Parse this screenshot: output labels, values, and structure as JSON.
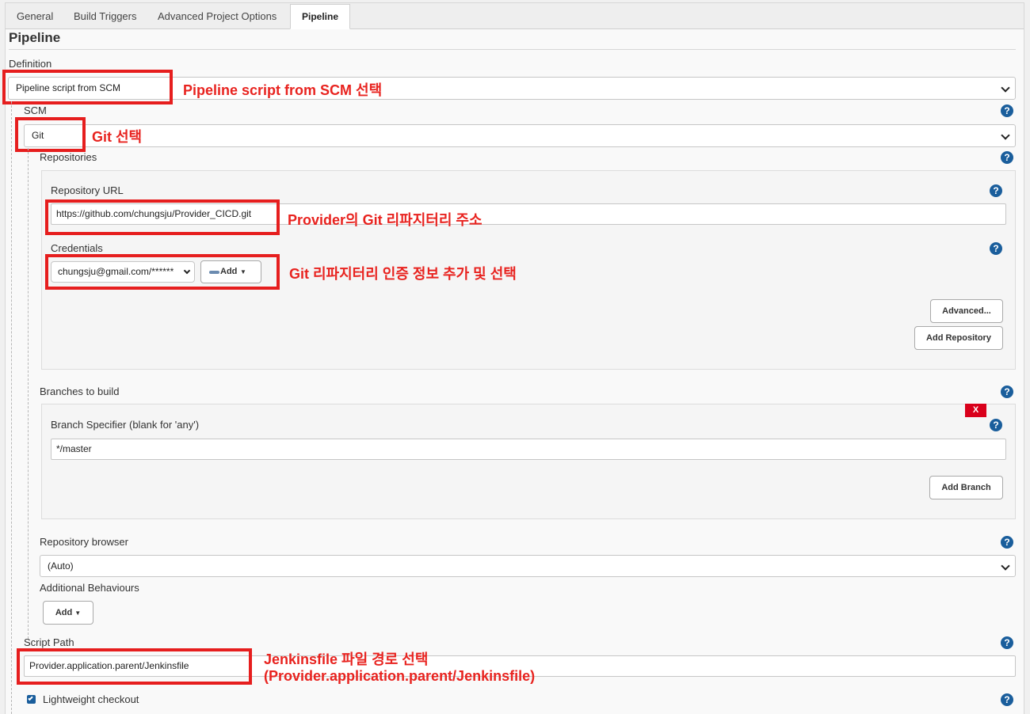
{
  "tabs": [
    {
      "label": "General"
    },
    {
      "label": "Build Triggers"
    },
    {
      "label": "Advanced Project Options"
    },
    {
      "label": "Pipeline"
    }
  ],
  "section_title": "Pipeline",
  "definition": {
    "label": "Definition",
    "value": "Pipeline script from SCM"
  },
  "scm": {
    "label": "SCM",
    "value": "Git"
  },
  "repositories": {
    "label": "Repositories",
    "url_label": "Repository URL",
    "url_value": "https://github.com/chungsju/Provider_CICD.git",
    "credentials_label": "Credentials",
    "credentials_value": "chungsju@gmail.com/******",
    "add_label": "Add",
    "advanced_label": "Advanced...",
    "add_repository_label": "Add Repository"
  },
  "branches": {
    "label": "Branches to build",
    "delete_label": "X",
    "specifier_label": "Branch Specifier (blank for 'any')",
    "specifier_value": "*/master",
    "add_branch_label": "Add Branch"
  },
  "repo_browser": {
    "label": "Repository browser",
    "value": "(Auto)"
  },
  "additional": {
    "label": "Additional Behaviours",
    "add_label": "Add"
  },
  "script_path": {
    "label": "Script Path",
    "value": "Provider.application.parent/Jenkinsfile"
  },
  "lightweight": {
    "label": "Lightweight checkout",
    "checked": true
  },
  "help_glyph": "?",
  "annotations": {
    "definition": "Pipeline script from SCM 선택",
    "scm": "Git 선택",
    "url": "Provider의 Git 리파지터리 주소",
    "credentials": "Git 리파지터리 인증 정보 추가 및 선택",
    "script_line1": "Jenkinsfile 파일 경로 선택",
    "script_line2": "(Provider.application.parent/Jenkinsfile)"
  },
  "colors": {
    "annotation_red": "#e8231f",
    "help_blue": "#1a5e9c",
    "delete_red": "#d9001b"
  }
}
